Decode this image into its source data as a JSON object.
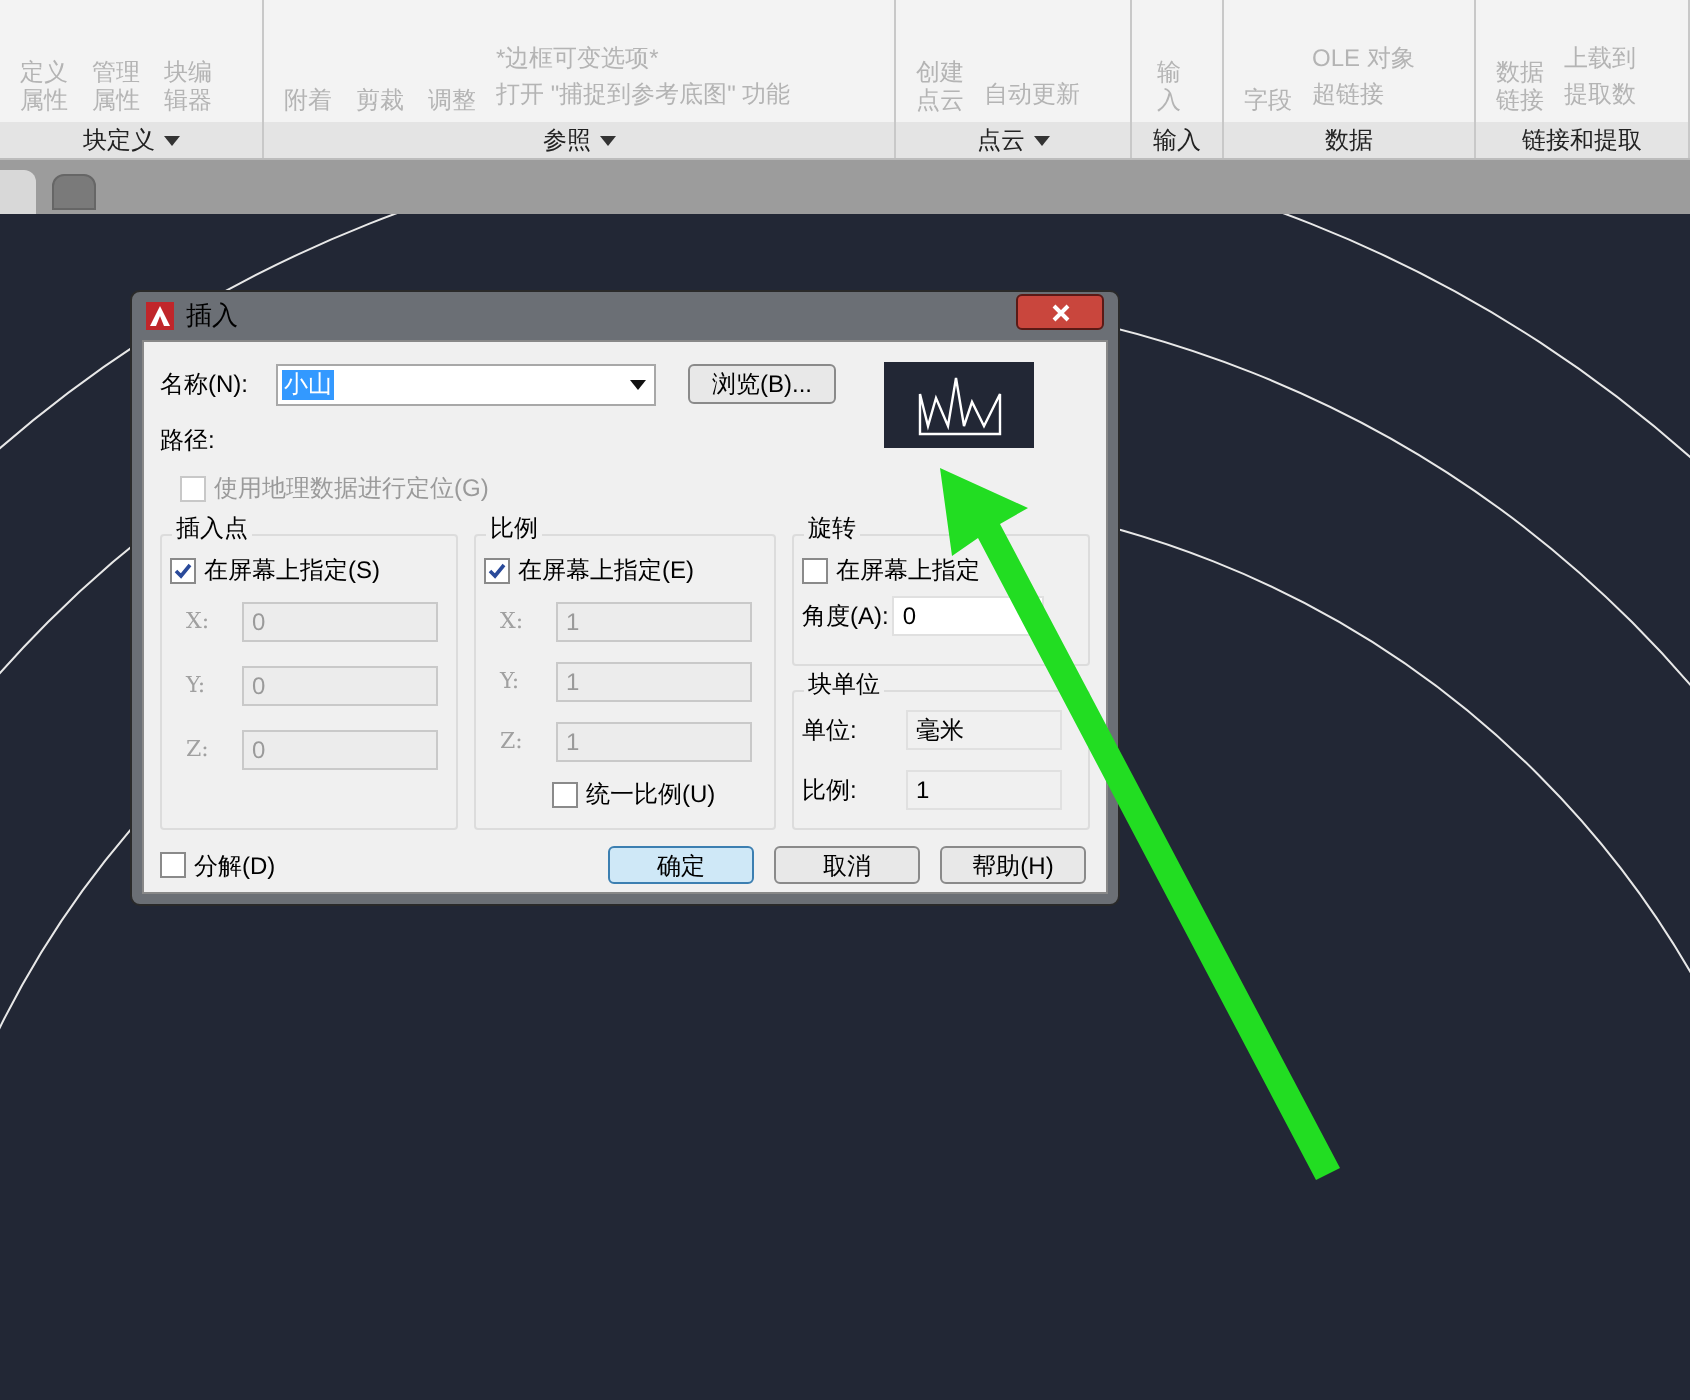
{
  "ribbon": {
    "panels": [
      {
        "title": "块定义",
        "has_menu": true,
        "items": [
          {
            "label": "定义属性",
            "kind": "large"
          },
          {
            "label": "管理属性",
            "kind": "large"
          },
          {
            "label": "块编辑器",
            "kind": "large"
          }
        ]
      },
      {
        "title": "参照",
        "has_menu": true,
        "items": [
          {
            "label": "附着",
            "kind": "large"
          },
          {
            "label": "剪裁",
            "kind": "large"
          },
          {
            "label": "调整",
            "kind": "large"
          },
          {
            "label": "*边框可变选项*",
            "kind": "small"
          },
          {
            "label": "打开 \"捕捉到参考底图\" 功能",
            "kind": "small"
          }
        ]
      },
      {
        "title": "点云",
        "has_menu": true,
        "items": [
          {
            "label": "创建点云",
            "kind": "large"
          },
          {
            "label": "自动更新",
            "kind": "small"
          }
        ]
      },
      {
        "title": "输入",
        "has_menu": false,
        "items": [
          {
            "label": "输入",
            "kind": "large"
          }
        ]
      },
      {
        "title": "数据",
        "has_menu": false,
        "items": [
          {
            "label": "字段",
            "kind": "large"
          },
          {
            "label": "OLE 对象",
            "kind": "small"
          },
          {
            "label": "超链接",
            "kind": "small"
          }
        ]
      },
      {
        "title": "链接和提取",
        "has_menu": false,
        "items": [
          {
            "label": "数据链接",
            "kind": "large"
          },
          {
            "label": "上载到",
            "kind": "small"
          },
          {
            "label": "提取数",
            "kind": "small"
          }
        ]
      }
    ]
  },
  "dialog": {
    "title": "插入",
    "name_label": "名称(N):",
    "name_value": "小山",
    "browse_button": "浏览(B)...",
    "path_label": "路径:",
    "geo_checkbox": {
      "label": "使用地理数据进行定位(G)",
      "checked": false,
      "disabled": true
    },
    "insertion_point": {
      "title": "插入点",
      "specify": {
        "label": "在屏幕上指定(S)",
        "checked": true
      },
      "fields": [
        {
          "label": "X:",
          "value": "0",
          "disabled": true
        },
        {
          "label": "Y:",
          "value": "0",
          "disabled": true
        },
        {
          "label": "Z:",
          "value": "0",
          "disabled": true
        }
      ]
    },
    "scale": {
      "title": "比例",
      "specify": {
        "label": "在屏幕上指定(E)",
        "checked": true
      },
      "fields": [
        {
          "label": "X:",
          "value": "1",
          "disabled": true
        },
        {
          "label": "Y:",
          "value": "1",
          "disabled": true
        },
        {
          "label": "Z:",
          "value": "1",
          "disabled": true
        }
      ],
      "uniform": {
        "label": "统一比例(U)",
        "checked": false
      }
    },
    "rotation": {
      "title": "旋转",
      "specify": {
        "label": "在屏幕上指定",
        "checked": false
      },
      "angle_label": "角度(A):",
      "angle_value": "0"
    },
    "block_unit": {
      "title": "块单位",
      "unit_label": "单位:",
      "unit_value": "毫米",
      "ratio_label": "比例:",
      "ratio_value": "1"
    },
    "explode": {
      "label": "分解(D)",
      "checked": false
    },
    "buttons": [
      {
        "label": "确定",
        "default": true
      },
      {
        "label": "取消",
        "default": false
      },
      {
        "label": "帮助(H)",
        "default": false
      }
    ]
  }
}
